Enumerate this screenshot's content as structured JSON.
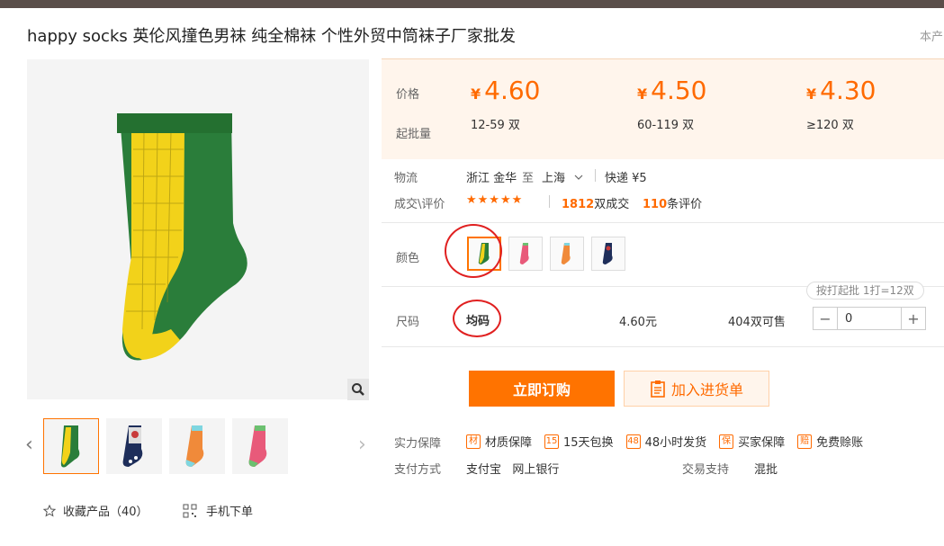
{
  "title": "happy socks 英伦风撞色男袜 纯全棉袜 个性外贸中筒袜子厂家批发",
  "report_link": "本产",
  "price_section": {
    "price_label": "价格",
    "moq_label": "起批量",
    "tiers": [
      {
        "currency": "¥",
        "price": "4.60",
        "range": "12-59 双"
      },
      {
        "currency": "¥",
        "price": "4.50",
        "range": "60-119 双"
      },
      {
        "currency": "¥",
        "price": "4.30",
        "range": "≥120 双"
      }
    ]
  },
  "logistics": {
    "label": "物流",
    "origin": "浙江 金华",
    "to": "至",
    "destination": "上海",
    "shipping": "快递 ¥5"
  },
  "reviews": {
    "label": "成交\\评价",
    "stars": "★★★★★",
    "deals_count": "1812",
    "deals_suffix": "双成交",
    "review_count": "110",
    "review_suffix": "条评价"
  },
  "color": {
    "label": "颜色",
    "options": [
      "green-yellow-sock",
      "pink-green-sock",
      "orange-blue-sock",
      "navy-red-sock"
    ]
  },
  "size": {
    "label": "尺码",
    "value": "均码",
    "price": "4.60元",
    "stock": "404双可售",
    "batch_note": "按打起批 1打=12双",
    "quantity": "0",
    "minus": "−",
    "plus": "+"
  },
  "actions": {
    "buy_label": "立即订购",
    "cart_label": "加入进货单"
  },
  "guarantee": {
    "label": "实力保障",
    "items": [
      {
        "icon": "材",
        "text": "材质保障"
      },
      {
        "icon": "15",
        "text": "15天包换"
      },
      {
        "icon": "48",
        "text": "48小时发货"
      },
      {
        "icon": "保",
        "text": "买家保障"
      },
      {
        "icon": "赔",
        "text": "免费赊账"
      }
    ]
  },
  "payment": {
    "label": "支付方式",
    "methods": "支付宝   网上银行",
    "support_label": "交易支持",
    "support_value": "混批"
  },
  "bottom": {
    "collect_label": "收藏产品（40）",
    "mobile_label": "手机下单"
  },
  "colors": {
    "accent": "#ff7300",
    "price": "#ff6a00",
    "annotation": "#e02020"
  }
}
